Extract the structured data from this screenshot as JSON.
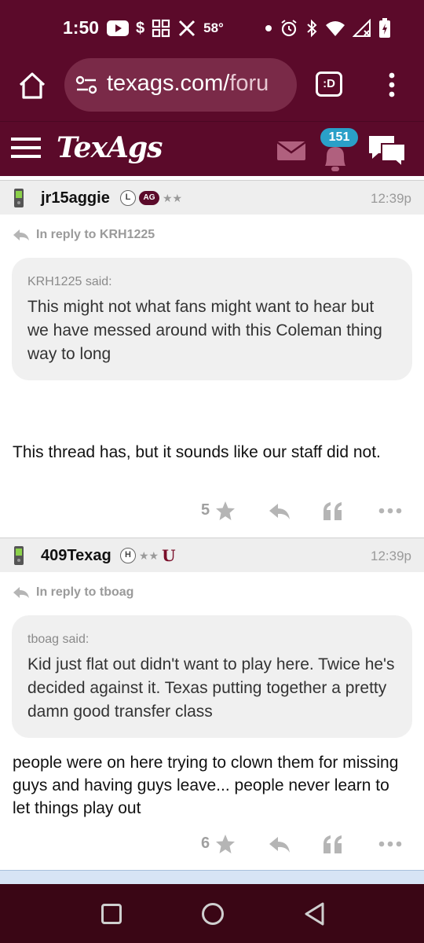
{
  "status_bar": {
    "time": "1:50",
    "temperature": "58°",
    "icons_left": [
      "youtube-icon",
      "dollar-icon",
      "app-grid-icon",
      "x-icon"
    ],
    "icons_right": [
      "dot-icon",
      "alarm-icon",
      "bluetooth-icon",
      "wifi-icon",
      "signal-icon",
      "battery-charging-icon"
    ],
    "dollar_glyph": "$"
  },
  "browser": {
    "url_main": "texags.com/",
    "url_faded": "foru",
    "tab_label": ":D"
  },
  "site_header": {
    "logo": "TexAgs",
    "notification_count": "151",
    "brand_color": "#5b0a2a",
    "badge_color": "#2aa0c8"
  },
  "posts": [
    {
      "username": "jr15aggie",
      "badge_l": "L",
      "badge_ag": "AG",
      "stars": "★★",
      "time": "12:39p",
      "reply_to": "In reply to KRH1225",
      "quote_author": "KRH1225 said:",
      "quote_text": "This might not what fans might want to hear but we have messed around with this Coleman thing way to long",
      "body": "This thread has, but it sounds like our staff did not.",
      "star_count": "5"
    },
    {
      "username": "409Texag",
      "badge_h": "H",
      "stars": "★★",
      "badge_u": "U",
      "time": "12:39p",
      "reply_to": "In reply to tboag",
      "quote_author": "tboag said:",
      "quote_text": "Kid just flat out didn't want to play here. Twice he's decided against it. Texas putting together a pretty damn good transfer class",
      "body": "people were on here trying to clown them for missing guys and having guys leave... people never learn to let things play out",
      "star_count": "6"
    }
  ]
}
